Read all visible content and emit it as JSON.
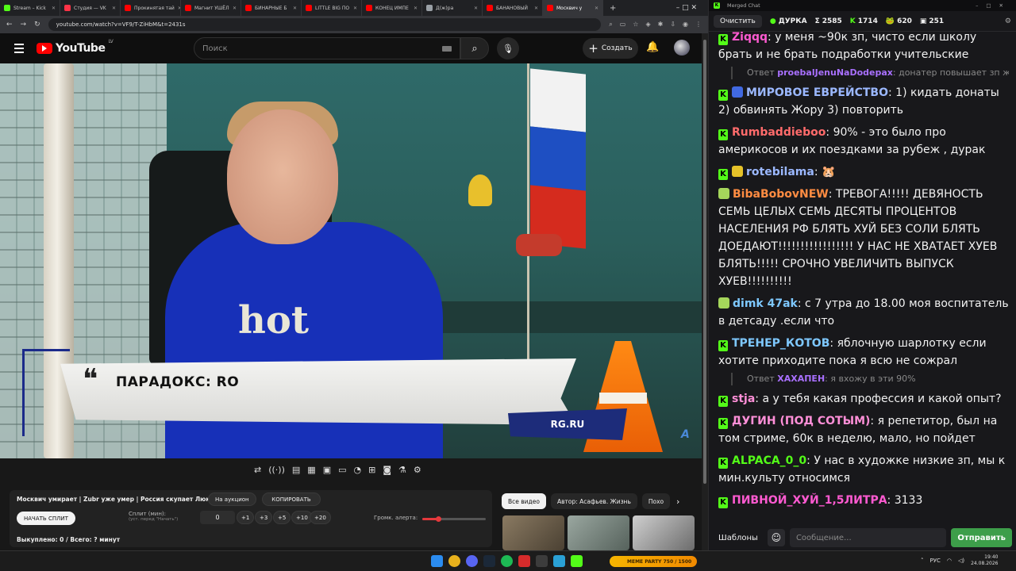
{
  "browser": {
    "tabs": [
      {
        "label": "Stream – Kick",
        "color": "#53fc18"
      },
      {
        "label": "Студия — VK",
        "color": "#ff3347"
      },
      {
        "label": "Прокинятая тай",
        "color": "#ff0000"
      },
      {
        "label": "Магнит УШЁЛ",
        "color": "#ff0000"
      },
      {
        "label": "БИНАРНЫЕ Б",
        "color": "#ff0000"
      },
      {
        "label": "LITTLE BIG ПО",
        "color": "#ff0000"
      },
      {
        "label": "КОНЕЦ ИМПЕ",
        "color": "#ff0000"
      },
      {
        "label": "Д(ж)ра",
        "color": "#9aa0a6"
      },
      {
        "label": "БАНАНОВЫЙ",
        "color": "#ff0000"
      },
      {
        "label": "Москвич у",
        "color": "#ff0000"
      }
    ],
    "url": "youtube.com/watch?v=VF9/T-ZiHbM&t=2431s"
  },
  "youtube": {
    "logo": "YouTube",
    "region": "LV",
    "search_placeholder": "Поиск",
    "create_label": "Создать"
  },
  "video": {
    "lower_third": "ПАРАДОКС: RO",
    "tag": "RG.RU",
    "shirt_text": "hot"
  },
  "panel": {
    "title": "Москвич умирает | Zubr уже умер | Россия скупает Люкс",
    "auction_btn": "На аукцион",
    "copy_btn": "КОПИРОВАТЬ",
    "start_split": "НАЧАТЬ СПЛИТ",
    "split_label": "Сплит (мин):",
    "split_hint": "(уст. перед \"Начать\")",
    "split_value": "0",
    "inc": [
      "+1",
      "+3",
      "+5",
      "+10",
      "+20"
    ],
    "alert_volume_label": "Громк. алерта:",
    "alert_volume": 0.25,
    "bought": "Выкуплено: 0 / Всего: ? минут"
  },
  "chips": [
    "Все видео",
    "Автор: Асафьев. Жизнь",
    "Похо"
  ],
  "chat": {
    "window_title": "Merged Chat",
    "clear_label": "Очистить",
    "channel": "ДУРКА",
    "stats": [
      {
        "icon": "Σ",
        "value": "2585"
      },
      {
        "icon": "K",
        "value": "1714"
      },
      {
        "icon": "🐸",
        "value": "620"
      },
      {
        "icon": "▣",
        "value": "251"
      }
    ],
    "messages": [
      {
        "src": "kick",
        "user": "Ziqqq",
        "color": "#ff5ad1",
        "text": "у меня ~90к зп, чисто если школу брать и не брать подработки учительские"
      },
      {
        "reply": true,
        "prefix": "Ответ",
        "user": "proebalJenuNaDodepax",
        "text": "донатер повышает зп ж..."
      },
      {
        "src": "kick",
        "badge": "#4169e1",
        "user": "МИРОВОЕ ЕВРЕЙСТВО",
        "color": "#9bb8ff",
        "text": "1) кидать донаты 2) обвинять Жору 3) повторить"
      },
      {
        "src": "kick",
        "user": "Rumbaddieboo",
        "color": "#ff6b6b",
        "text": "90% - это было про америкосов и их поездками за рубеж , дурак"
      },
      {
        "src": "kick",
        "badge": "#e6c229",
        "user": "rotebilama",
        "color": "#9bb8ff",
        "text": "🐹"
      },
      {
        "src": "twitch",
        "badge": "#a5d65b",
        "user": "BibaBobovNEW",
        "color": "#ff8c42",
        "text": "ТРЕВОГА!!!!! ДЕВЯНОСТЬ СЕМЬ ЦЕЛЫХ СЕМЬ ДЕСЯТЫ ПРОЦЕНТОВ НАСЕЛЕНИЯ РФ БЛЯТЬ ХУЙ БЕЗ СОЛИ БЛЯТЬ ДОЕДАЮТ!!!!!!!!!!!!!!!!! У НАС НЕ ХВАТАЕТ ХУЕВ БЛЯТЬ!!!!! СРОЧНО УВЕЛИЧИТЬ ВЫПУСК ХУЕВ!!!!!!!!!!"
      },
      {
        "src": "twitch",
        "badge": "#a5d65b",
        "user": "dimk 47ak",
        "color": "#7ec8ff",
        "text": "с 7 утра до 18.00 моя воспитатель в детсаду .если что"
      },
      {
        "src": "kick",
        "user": "ТРЕНЕР_КОТОВ",
        "color": "#7ec8ff",
        "text": "яблочную шарлотку если хотите приходите пока я всю не сожрал"
      },
      {
        "reply": true,
        "prefix": "Ответ",
        "user": "ХАХАПЕН",
        "text": "я вхожу в эти 90%"
      },
      {
        "src": "kick",
        "user": "stja",
        "color": "#ff8fd8",
        "text": "а у тебя какая профессия и какой опыт?"
      },
      {
        "src": "kick",
        "user": "ДУГИН (ПОД СОТЫМ)",
        "color": "#ff8fd8",
        "text": "я репетитор, был на том стриме, 60к в неделю, мало, но пойдет"
      },
      {
        "src": "kick",
        "user": "ALPACA_0_0",
        "color": "#53fc18",
        "text": "У нас в художке низкие зп, мы к мин.культу относимся"
      },
      {
        "src": "kick",
        "user": "ПИВНОЙ_ХУЙ_1,5ЛИТРА",
        "color": "#ff5ad1",
        "text": "3133"
      }
    ],
    "templates_label": "Шаблоны",
    "input_placeholder": "Сообщение...",
    "send_label": "Отправить"
  },
  "taskbar": {
    "widget": "MEME PARTY",
    "widget_sub": "750 / 1500",
    "lang": "РУС",
    "time": "19:40",
    "date": "24.08.2026"
  }
}
